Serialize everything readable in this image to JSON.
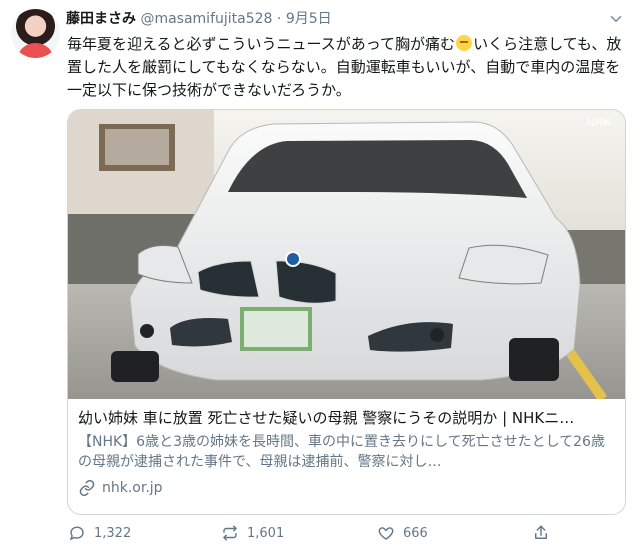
{
  "author": {
    "name": "藤田まさみ",
    "handle": "@masamifujita528",
    "separator": "·",
    "date": "9月5日"
  },
  "tweet": {
    "text_before_emoji": "毎年夏を迎えると必ずこういうニュースがあって胸が痛む",
    "text_after_emoji": "いくら注意しても、放置した人を厳罰にしてもなくならない。自動運転車もいいが、自動で車内の温度を一定以下に保つ技術ができないだろうか。"
  },
  "card": {
    "watermark": "NHK",
    "title": "幼い姉妹 車に放置 死亡させた疑いの母親 警察にうその説明か | NHKニ…",
    "description": "【NHK】6歳と3歳の姉妹を長時間、車の中に置き去りにして死亡させたとして26歳の母親が逮捕された事件で、母親は逮捕前、警察に対し…",
    "domain": "nhk.or.jp"
  },
  "actions": {
    "reply_count": "1,322",
    "retweet_count": "1,601",
    "like_count": "666"
  },
  "colors": {
    "text": "#14171a",
    "muted": "#657786",
    "border": "#ccd6dd",
    "background": "#ffffff"
  },
  "icons": {
    "chevron": "chevron-down-icon",
    "link": "link-icon",
    "reply": "reply-icon",
    "retweet": "retweet-icon",
    "like": "like-icon",
    "share": "share-icon"
  }
}
